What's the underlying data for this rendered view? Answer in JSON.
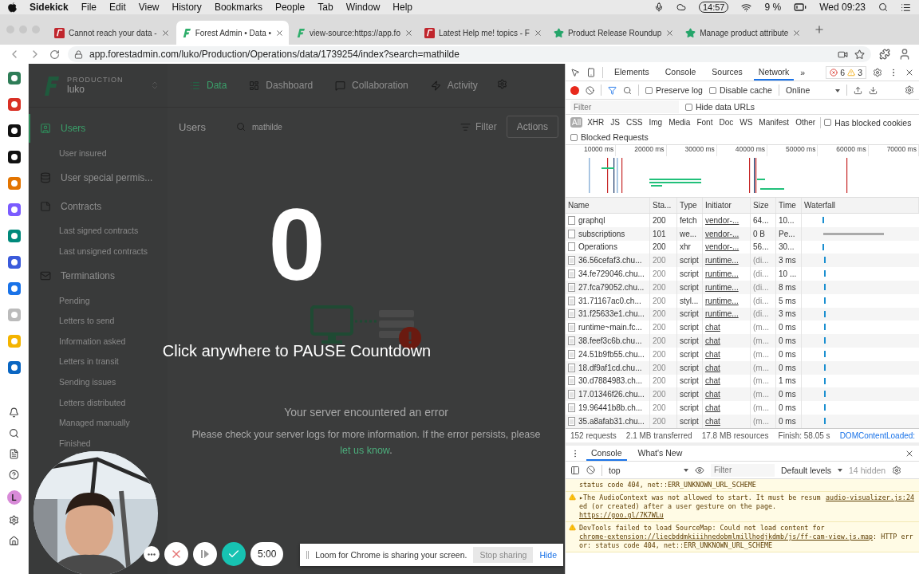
{
  "menubar": {
    "app": "Sidekick",
    "menus": [
      "File",
      "Edit",
      "View",
      "History",
      "Bookmarks",
      "People",
      "Tab",
      "Window",
      "Help"
    ],
    "clock": "14:57",
    "battery": "9 %",
    "datetime": "Wed 09:23"
  },
  "tabs": [
    {
      "title": "Cannot reach your data -",
      "selected": false
    },
    {
      "title": "Forest Admin • Data •",
      "selected": true
    },
    {
      "title": "view-source:https://app.fo",
      "selected": false
    },
    {
      "title": "Latest Help me! topics - F",
      "selected": false
    },
    {
      "title": "Product Release Roundup",
      "selected": false
    },
    {
      "title": "Manage product attribute",
      "selected": false
    }
  ],
  "address": "app.forestadmin.com/luko/Production/Operations/data/1739254/index?search=mathilde",
  "dock": {
    "avatar": "L"
  },
  "app": {
    "environment": "PRODUCTION",
    "project": "luko",
    "nav": [
      {
        "label": "Data",
        "selected": true
      },
      {
        "label": "Dashboard",
        "selected": false
      },
      {
        "label": "Collaboration",
        "selected": false
      },
      {
        "label": "Activity",
        "selected": false
      }
    ],
    "sidebar": [
      {
        "kind": "collection",
        "label": "Users",
        "selected": true
      },
      {
        "kind": "segment",
        "label": "User insured",
        "selected": false
      },
      {
        "kind": "collection",
        "label": "User special permis...",
        "selected": false
      },
      {
        "kind": "collection",
        "label": "Contracts",
        "selected": false
      },
      {
        "kind": "segment",
        "label": "Last signed contracts",
        "selected": false
      },
      {
        "kind": "segment",
        "label": "Last unsigned contracts",
        "selected": false
      },
      {
        "kind": "collection",
        "label": "Terminations",
        "selected": false
      },
      {
        "kind": "segment",
        "label": "Pending",
        "selected": false
      },
      {
        "kind": "segment",
        "label": "Letters to send",
        "selected": false
      },
      {
        "kind": "segment",
        "label": "Information asked",
        "selected": false
      },
      {
        "kind": "segment",
        "label": "Letters in transit",
        "selected": false
      },
      {
        "kind": "segment",
        "label": "Sending issues",
        "selected": false
      },
      {
        "kind": "segment",
        "label": "Letters distributed",
        "selected": false
      },
      {
        "kind": "segment",
        "label": "Managed manually",
        "selected": false
      },
      {
        "kind": "segment",
        "label": "Finished",
        "selected": false
      }
    ],
    "content": {
      "title": "Users",
      "search": "mathilde",
      "filter": "Filter",
      "actions": "Actions",
      "error_title": "Your server encountered an error",
      "error_message": "Please check your server logs for more information. If the error persists, please ",
      "error_link": "let us know",
      "error_end": "."
    }
  },
  "recorder": {
    "countdown": "0",
    "hint": "Click anywhere to PAUSE Countdown",
    "timer": "5:00",
    "sharing": {
      "message": "Loom for Chrome is sharing your screen.",
      "stop": "Stop sharing",
      "hide": "Hide"
    }
  },
  "devtools": {
    "tabs": [
      {
        "label": "Elements",
        "selected": false
      },
      {
        "label": "Console",
        "selected": false
      },
      {
        "label": "Sources",
        "selected": false
      },
      {
        "label": "Network",
        "selected": true
      }
    ],
    "more": "»",
    "errors": "6",
    "warnings": "3",
    "network": {
      "recording": true,
      "preserve_log": {
        "label": "Preserve log",
        "checked": false
      },
      "disable_cache": {
        "label": "Disable cache",
        "checked": false
      },
      "throttle": "Online",
      "filter_placeholder": "Filter",
      "hide_data_urls": {
        "label": "Hide data URLs",
        "checked": false
      },
      "types": [
        {
          "label": "All",
          "selected": true
        },
        {
          "label": "XHR",
          "selected": false
        },
        {
          "label": "JS",
          "selected": false
        },
        {
          "label": "CSS",
          "selected": false
        },
        {
          "label": "Img",
          "selected": false
        },
        {
          "label": "Media",
          "selected": false
        },
        {
          "label": "Font",
          "selected": false
        },
        {
          "label": "Doc",
          "selected": false
        },
        {
          "label": "WS",
          "selected": false
        },
        {
          "label": "Manifest",
          "selected": false
        },
        {
          "label": "Other",
          "selected": false
        }
      ],
      "blocked_cookies": {
        "label": "Has blocked cookies",
        "checked": false
      },
      "blocked_requests": {
        "label": "Blocked Requests",
        "checked": false
      },
      "timeline_ticks": [
        "10000 ms",
        "20000 ms",
        "30000 ms",
        "40000 ms",
        "50000 ms",
        "60000 ms",
        "70000 ms"
      ],
      "columns": [
        "Name",
        "Sta...",
        "Type",
        "Initiator",
        "Size",
        "Time",
        "Waterfall"
      ],
      "rows": [
        {
          "name": "graphql",
          "status": "200",
          "type": "fetch",
          "initiator": "vendor-...",
          "size": "64...",
          "time": "10...",
          "cached": false
        },
        {
          "name": "subscriptions",
          "status": "101",
          "type": "we...",
          "initiator": "vendor-...",
          "size": "0 B",
          "time": "Pe...",
          "cached": false
        },
        {
          "name": "Operations",
          "status": "200",
          "type": "xhr",
          "initiator": "vendor-...",
          "size": "56...",
          "time": "30...",
          "cached": false
        },
        {
          "name": "36.56cefaf3.chu...",
          "status": "200",
          "type": "script",
          "initiator": "runtime...",
          "size": "(di...",
          "time": "3 ms",
          "cached": true
        },
        {
          "name": "34.fe729046.chu...",
          "status": "200",
          "type": "script",
          "initiator": "runtime...",
          "size": "(di...",
          "time": "10 ...",
          "cached": true
        },
        {
          "name": "27.fca79052.chu...",
          "status": "200",
          "type": "script",
          "initiator": "runtime...",
          "size": "(di...",
          "time": "8 ms",
          "cached": true
        },
        {
          "name": "31.71167ac0.ch...",
          "status": "200",
          "type": "styl...",
          "initiator": "runtime...",
          "size": "(di...",
          "time": "5 ms",
          "cached": true
        },
        {
          "name": "31.f25633e1.chu...",
          "status": "200",
          "type": "script",
          "initiator": "runtime...",
          "size": "(di...",
          "time": "3 ms",
          "cached": true
        },
        {
          "name": "runtime~main.fc...",
          "status": "200",
          "type": "script",
          "initiator": "chat",
          "size": "(m...",
          "time": "0 ms",
          "cached": true
        },
        {
          "name": "38.feef3c6b.chu...",
          "status": "200",
          "type": "script",
          "initiator": "chat",
          "size": "(m...",
          "time": "0 ms",
          "cached": true
        },
        {
          "name": "24.51b9fb55.chu...",
          "status": "200",
          "type": "script",
          "initiator": "chat",
          "size": "(m...",
          "time": "0 ms",
          "cached": true
        },
        {
          "name": "18.df9af1cd.chu...",
          "status": "200",
          "type": "script",
          "initiator": "chat",
          "size": "(m...",
          "time": "0 ms",
          "cached": true
        },
        {
          "name": "30.d7884983.ch...",
          "status": "200",
          "type": "script",
          "initiator": "chat",
          "size": "(m...",
          "time": "1 ms",
          "cached": true
        },
        {
          "name": "17.01346f26.chu...",
          "status": "200",
          "type": "script",
          "initiator": "chat",
          "size": "(m...",
          "time": "0 ms",
          "cached": true
        },
        {
          "name": "19.96441b8b.ch...",
          "status": "200",
          "type": "script",
          "initiator": "chat",
          "size": "(m...",
          "time": "0 ms",
          "cached": true
        },
        {
          "name": "35.a8afab31.chu...",
          "status": "200",
          "type": "script",
          "initiator": "chat",
          "size": "(m...",
          "time": "0 ms",
          "cached": true
        }
      ],
      "summary": [
        "152 requests",
        "2.1 MB transferred",
        "17.8 MB resources",
        "Finish: 58.05 s"
      ],
      "dom_loaded": "DOMContentLoaded:"
    },
    "drawer": {
      "tabs": [
        {
          "label": "Console",
          "selected": true
        },
        {
          "label": "What's New",
          "selected": false
        }
      ],
      "context": "top",
      "filter_placeholder": "Filter",
      "levels": "Default levels",
      "hidden": "14 hidden",
      "messages": [
        {
          "kind": "continuation",
          "text": "status code 404, net::ERR_UNKNOWN_URL_SCHEME"
        },
        {
          "kind": "warning",
          "source": "audio-visualizer.js:24",
          "text": "▸The AudioContext was not allowed to start. It must be resumed (or created) after a user gesture on the page. ",
          "link": "https://goo.gl/7K7WLu"
        },
        {
          "kind": "warning",
          "text": "DevTools failed to load SourceMap: Could not load content for ",
          "link": "chrome-extension://liecbddmkiiihnedobmlmillhodjkdmb/js/ff-cam-view.js.map",
          "after": ": HTTP error: status code 404, net::ERR_UNKNOWN_URL_SCHEME"
        }
      ]
    }
  }
}
